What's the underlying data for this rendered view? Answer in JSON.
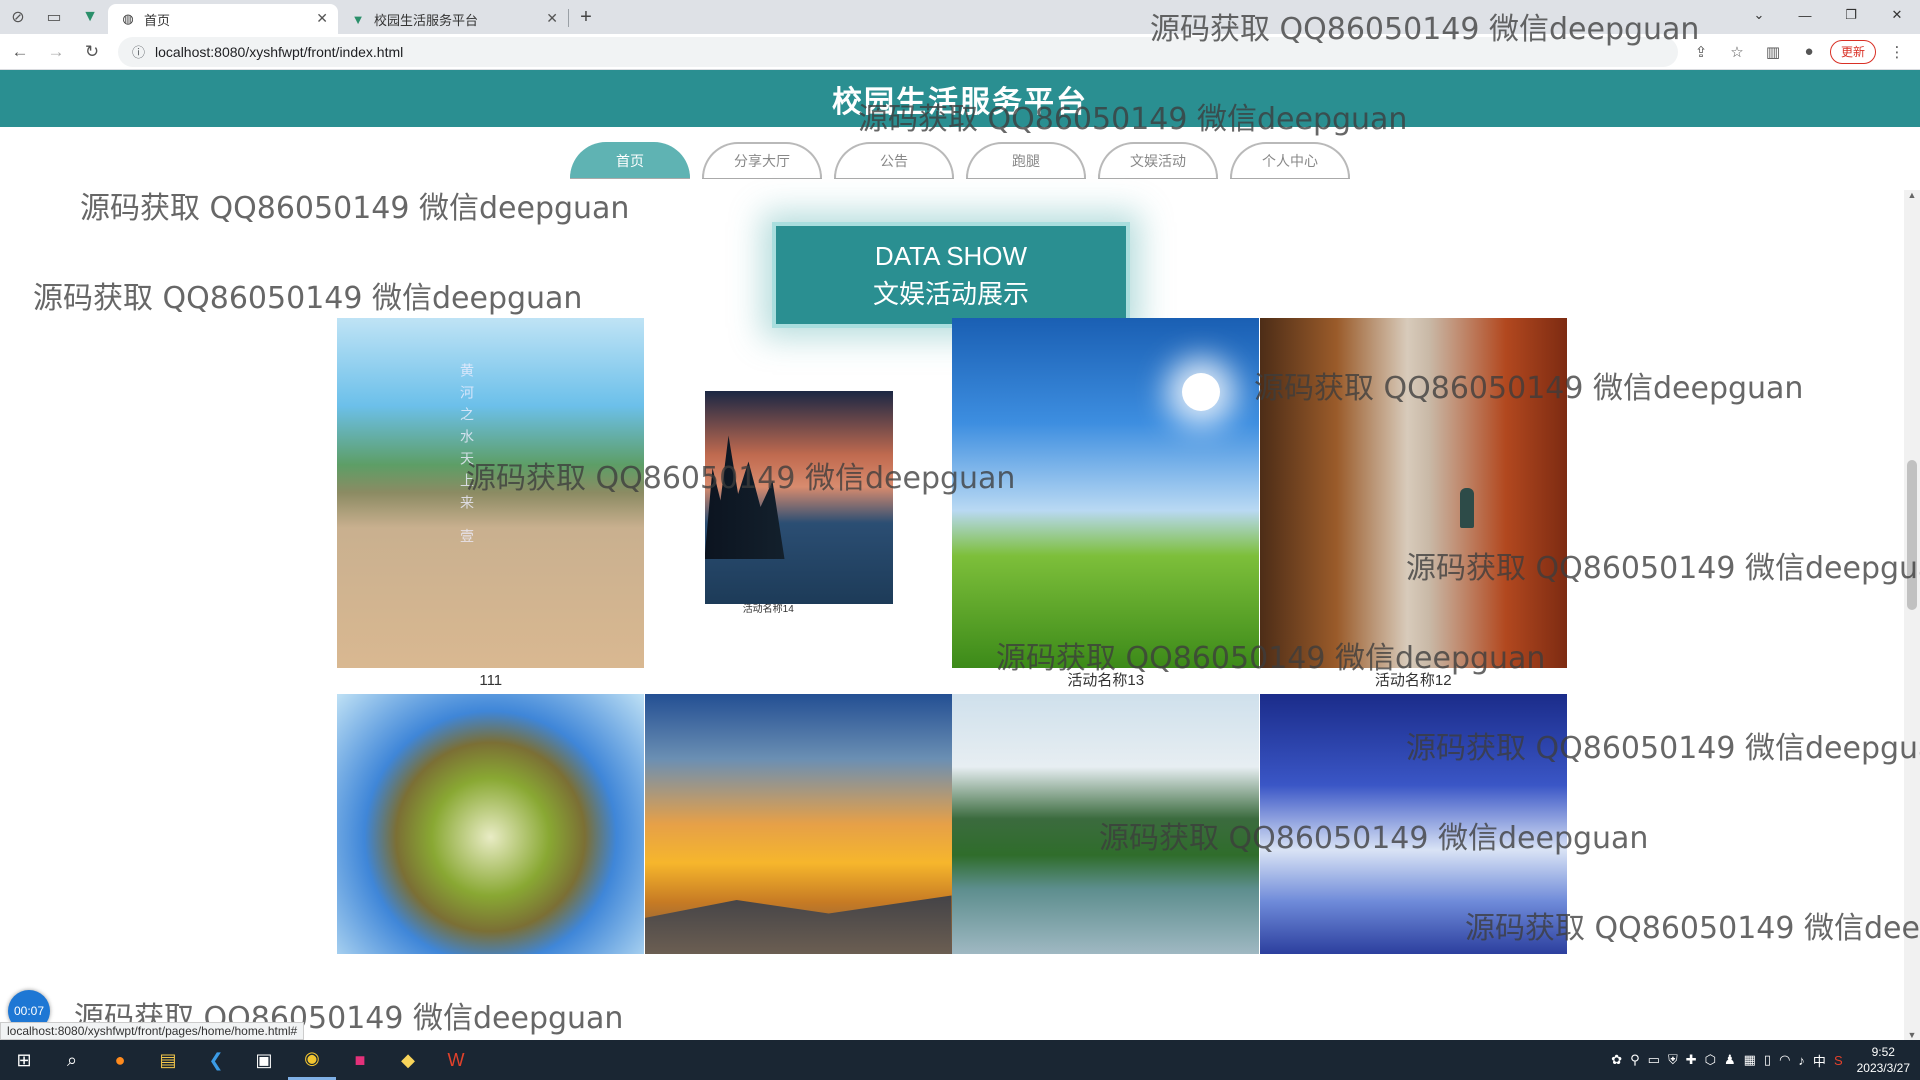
{
  "browser": {
    "tabs": [
      {
        "title": "首页",
        "active": true
      },
      {
        "title": "校园生活服务平台",
        "active": false
      }
    ],
    "url": "localhost:8080/xyshfwpt/front/index.html",
    "update_label": "更新",
    "status_link": "localhost:8080/xyshfwpt/front/pages/home/home.html#"
  },
  "site": {
    "title": "校园生活服务平台",
    "nav": [
      "首页",
      "分享大厅",
      "公告",
      "跑腿",
      "文娱活动",
      "个人中心"
    ],
    "active_nav": "首页",
    "banner": {
      "line1": "DATA SHOW",
      "line2": "文娱活动展示"
    },
    "accent_color": "#2a8f91"
  },
  "gallery": {
    "row1": [
      {
        "caption": "111",
        "scene": "river"
      },
      {
        "caption": "活动名称14",
        "scene": "lake"
      },
      {
        "caption": "活动名称13",
        "scene": "grass"
      },
      {
        "caption": "活动名称12",
        "scene": "corridor"
      }
    ],
    "row2": [
      {
        "caption": "",
        "scene": "planet"
      },
      {
        "caption": "",
        "scene": "sunset"
      },
      {
        "caption": "",
        "scene": "karst"
      },
      {
        "caption": "",
        "scene": "clouds"
      }
    ],
    "river_text": "黄河之水天上来 壹"
  },
  "watermark": "源码获取 QQ86050149 微信deepguan",
  "recorder": "00:07",
  "taskbar": {
    "time": "9:52",
    "date": "2023/3/27",
    "ime": "中"
  }
}
